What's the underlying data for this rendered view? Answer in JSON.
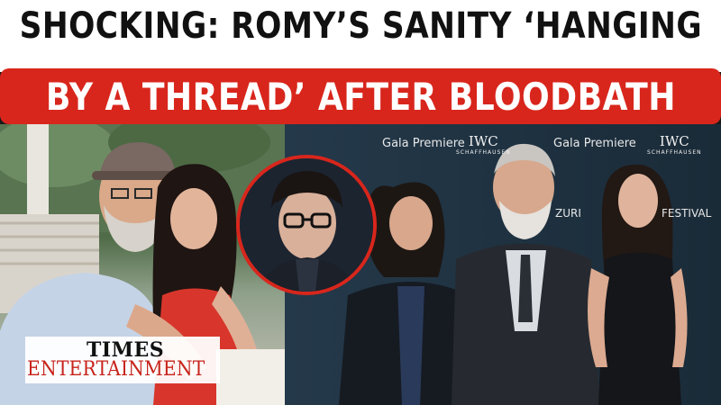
{
  "headline": {
    "line1": "SHOCKING: ROMY’S SANITY ‘HANGING",
    "line2": "BY A THREAD’ AFTER BLOODBATH"
  },
  "backdrop": {
    "event_left": "Gala Premiere",
    "event_right": "Gala Premiere",
    "brand": "IWC",
    "brand_sub": "SCHAFFHAUSEN",
    "brand_right": "IWC",
    "brand_right_sub": "SCHAFFHAUSEN",
    "festival_fragment": "FESTIVAL",
    "zurich_fragment": "ZURI"
  },
  "logo": {
    "top": "TIMES",
    "bottom": "ENTERTAINMENT"
  },
  "colors": {
    "headline_band": "#d8261c",
    "inset_ring": "#d8261c",
    "logo_red": "#c7231b"
  }
}
